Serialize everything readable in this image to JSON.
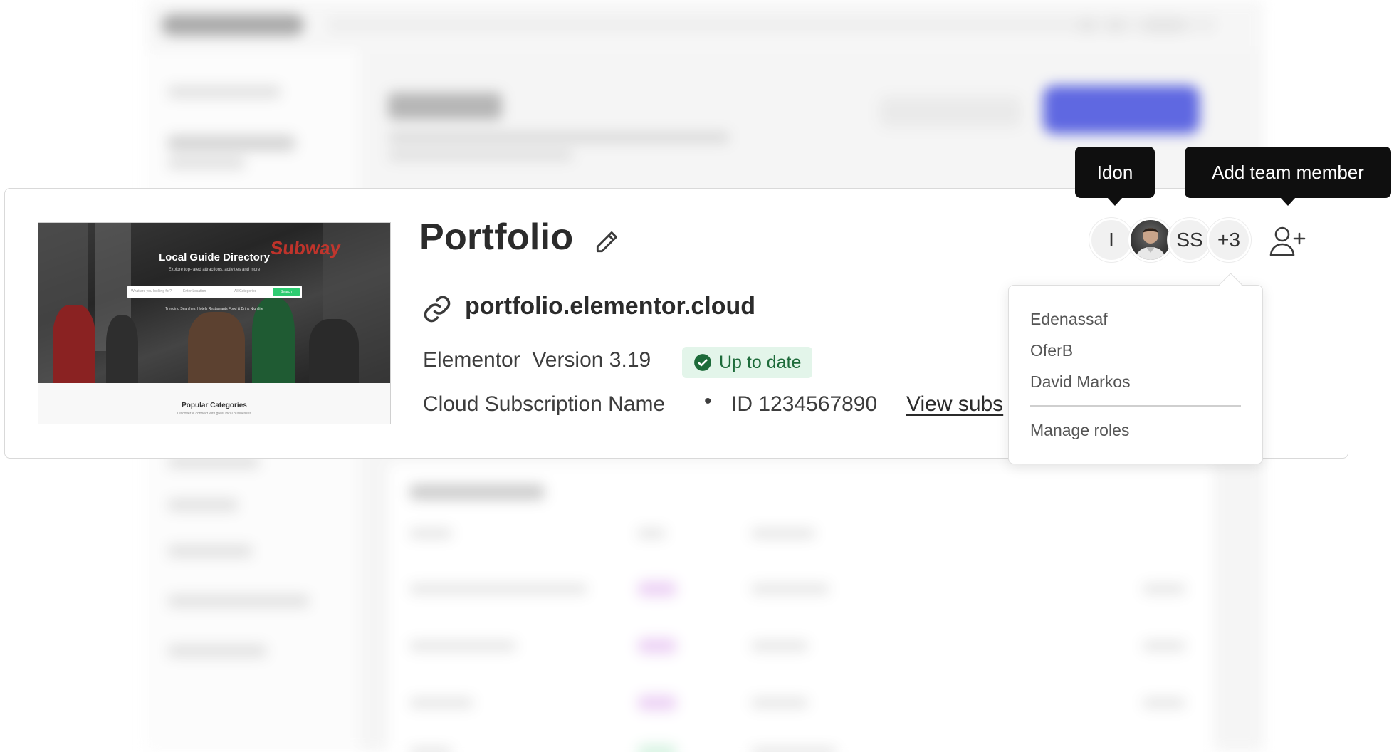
{
  "site": {
    "title": "Portfolio",
    "url": "portfolio.elementor.cloud",
    "product": "Elementor",
    "version": "Version 3.19",
    "status": "Up to date",
    "subscription_name": "Cloud Subscription Name",
    "separator": "•",
    "subscription_id": "ID 1234567890",
    "view_link": "View subs"
  },
  "thumbnail": {
    "title": "Local Guide Directory",
    "subtitle": "Explore top-rated attractions, activities and more",
    "search_placeholder": "What are you looking for?",
    "location_placeholder": "Enter Location",
    "category_placeholder": "All Categories",
    "search_button": "Search",
    "tags": "Trending Searches:  Hotels  Restaurants  Food & Drink  Nightlife",
    "sign": "Subway",
    "popular_title": "Popular Categories",
    "popular_subtitle": "Discover & connect with great local businesses"
  },
  "team": {
    "avatars": [
      {
        "initials": "I"
      },
      {
        "initials": ""
      },
      {
        "initials": "SS"
      },
      {
        "initials": "+3"
      }
    ],
    "tooltip_member": "Idon",
    "tooltip_add": "Add team member"
  },
  "dropdown": {
    "members": [
      "Edenassaf",
      "OferB",
      "David Markos"
    ],
    "manage_roles": "Manage roles"
  },
  "colors": {
    "badge_bg": "#e3f5ea",
    "badge_text": "#1d6b3a",
    "check": "#1d6b3a",
    "tooltip_bg": "#0f0f0f",
    "background_primary_button": "#2a36d8"
  }
}
